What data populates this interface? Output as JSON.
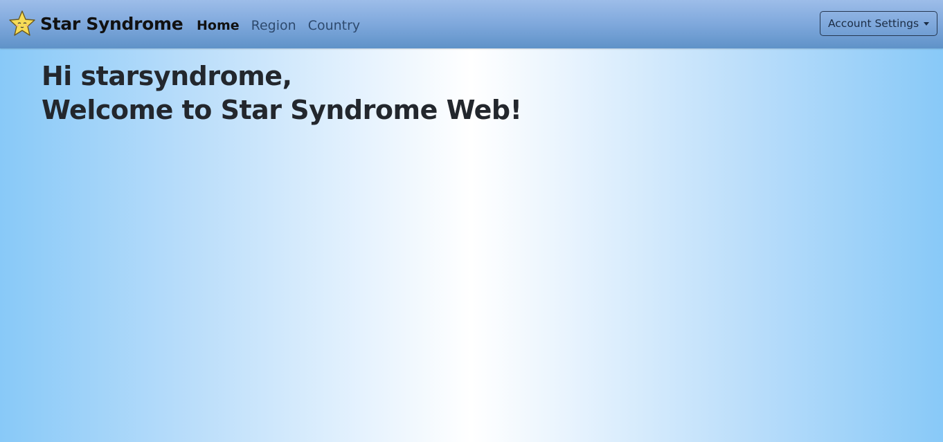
{
  "navbar": {
    "brand_name": "Star Syndrome",
    "brand_icon": "star-mascot-icon",
    "links": [
      {
        "label": "Home",
        "active": true
      },
      {
        "label": "Region",
        "active": false
      },
      {
        "label": "Country",
        "active": false
      }
    ],
    "account_button_label": "Account Settings",
    "account_button_icon": "caret-down-icon"
  },
  "main": {
    "greeting": "Hi starsyndrome,",
    "welcome": "Welcome to Star Syndrome Web!"
  },
  "colors": {
    "navbar_top": "#9dbde9",
    "navbar_bottom": "#5f92c8",
    "background_edge": "#88c9f8",
    "background_center": "#ffffff",
    "text_dark": "#23272d"
  }
}
